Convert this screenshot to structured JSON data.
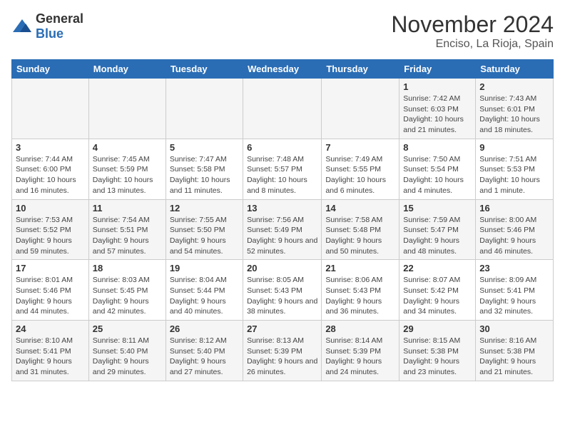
{
  "header": {
    "logo_general": "General",
    "logo_blue": "Blue",
    "month_title": "November 2024",
    "location": "Enciso, La Rioja, Spain"
  },
  "weekdays": [
    "Sunday",
    "Monday",
    "Tuesday",
    "Wednesday",
    "Thursday",
    "Friday",
    "Saturday"
  ],
  "weeks": [
    [
      {
        "day": "",
        "sunrise": "",
        "sunset": "",
        "daylight": ""
      },
      {
        "day": "",
        "sunrise": "",
        "sunset": "",
        "daylight": ""
      },
      {
        "day": "",
        "sunrise": "",
        "sunset": "",
        "daylight": ""
      },
      {
        "day": "",
        "sunrise": "",
        "sunset": "",
        "daylight": ""
      },
      {
        "day": "",
        "sunrise": "",
        "sunset": "",
        "daylight": ""
      },
      {
        "day": "1",
        "sunrise": "Sunrise: 7:42 AM",
        "sunset": "Sunset: 6:03 PM",
        "daylight": "Daylight: 10 hours and 21 minutes."
      },
      {
        "day": "2",
        "sunrise": "Sunrise: 7:43 AM",
        "sunset": "Sunset: 6:01 PM",
        "daylight": "Daylight: 10 hours and 18 minutes."
      }
    ],
    [
      {
        "day": "3",
        "sunrise": "Sunrise: 7:44 AM",
        "sunset": "Sunset: 6:00 PM",
        "daylight": "Daylight: 10 hours and 16 minutes."
      },
      {
        "day": "4",
        "sunrise": "Sunrise: 7:45 AM",
        "sunset": "Sunset: 5:59 PM",
        "daylight": "Daylight: 10 hours and 13 minutes."
      },
      {
        "day": "5",
        "sunrise": "Sunrise: 7:47 AM",
        "sunset": "Sunset: 5:58 PM",
        "daylight": "Daylight: 10 hours and 11 minutes."
      },
      {
        "day": "6",
        "sunrise": "Sunrise: 7:48 AM",
        "sunset": "Sunset: 5:57 PM",
        "daylight": "Daylight: 10 hours and 8 minutes."
      },
      {
        "day": "7",
        "sunrise": "Sunrise: 7:49 AM",
        "sunset": "Sunset: 5:55 PM",
        "daylight": "Daylight: 10 hours and 6 minutes."
      },
      {
        "day": "8",
        "sunrise": "Sunrise: 7:50 AM",
        "sunset": "Sunset: 5:54 PM",
        "daylight": "Daylight: 10 hours and 4 minutes."
      },
      {
        "day": "9",
        "sunrise": "Sunrise: 7:51 AM",
        "sunset": "Sunset: 5:53 PM",
        "daylight": "Daylight: 10 hours and 1 minute."
      }
    ],
    [
      {
        "day": "10",
        "sunrise": "Sunrise: 7:53 AM",
        "sunset": "Sunset: 5:52 PM",
        "daylight": "Daylight: 9 hours and 59 minutes."
      },
      {
        "day": "11",
        "sunrise": "Sunrise: 7:54 AM",
        "sunset": "Sunset: 5:51 PM",
        "daylight": "Daylight: 9 hours and 57 minutes."
      },
      {
        "day": "12",
        "sunrise": "Sunrise: 7:55 AM",
        "sunset": "Sunset: 5:50 PM",
        "daylight": "Daylight: 9 hours and 54 minutes."
      },
      {
        "day": "13",
        "sunrise": "Sunrise: 7:56 AM",
        "sunset": "Sunset: 5:49 PM",
        "daylight": "Daylight: 9 hours and 52 minutes."
      },
      {
        "day": "14",
        "sunrise": "Sunrise: 7:58 AM",
        "sunset": "Sunset: 5:48 PM",
        "daylight": "Daylight: 9 hours and 50 minutes."
      },
      {
        "day": "15",
        "sunrise": "Sunrise: 7:59 AM",
        "sunset": "Sunset: 5:47 PM",
        "daylight": "Daylight: 9 hours and 48 minutes."
      },
      {
        "day": "16",
        "sunrise": "Sunrise: 8:00 AM",
        "sunset": "Sunset: 5:46 PM",
        "daylight": "Daylight: 9 hours and 46 minutes."
      }
    ],
    [
      {
        "day": "17",
        "sunrise": "Sunrise: 8:01 AM",
        "sunset": "Sunset: 5:46 PM",
        "daylight": "Daylight: 9 hours and 44 minutes."
      },
      {
        "day": "18",
        "sunrise": "Sunrise: 8:03 AM",
        "sunset": "Sunset: 5:45 PM",
        "daylight": "Daylight: 9 hours and 42 minutes."
      },
      {
        "day": "19",
        "sunrise": "Sunrise: 8:04 AM",
        "sunset": "Sunset: 5:44 PM",
        "daylight": "Daylight: 9 hours and 40 minutes."
      },
      {
        "day": "20",
        "sunrise": "Sunrise: 8:05 AM",
        "sunset": "Sunset: 5:43 PM",
        "daylight": "Daylight: 9 hours and 38 minutes."
      },
      {
        "day": "21",
        "sunrise": "Sunrise: 8:06 AM",
        "sunset": "Sunset: 5:43 PM",
        "daylight": "Daylight: 9 hours and 36 minutes."
      },
      {
        "day": "22",
        "sunrise": "Sunrise: 8:07 AM",
        "sunset": "Sunset: 5:42 PM",
        "daylight": "Daylight: 9 hours and 34 minutes."
      },
      {
        "day": "23",
        "sunrise": "Sunrise: 8:09 AM",
        "sunset": "Sunset: 5:41 PM",
        "daylight": "Daylight: 9 hours and 32 minutes."
      }
    ],
    [
      {
        "day": "24",
        "sunrise": "Sunrise: 8:10 AM",
        "sunset": "Sunset: 5:41 PM",
        "daylight": "Daylight: 9 hours and 31 minutes."
      },
      {
        "day": "25",
        "sunrise": "Sunrise: 8:11 AM",
        "sunset": "Sunset: 5:40 PM",
        "daylight": "Daylight: 9 hours and 29 minutes."
      },
      {
        "day": "26",
        "sunrise": "Sunrise: 8:12 AM",
        "sunset": "Sunset: 5:40 PM",
        "daylight": "Daylight: 9 hours and 27 minutes."
      },
      {
        "day": "27",
        "sunrise": "Sunrise: 8:13 AM",
        "sunset": "Sunset: 5:39 PM",
        "daylight": "Daylight: 9 hours and 26 minutes."
      },
      {
        "day": "28",
        "sunrise": "Sunrise: 8:14 AM",
        "sunset": "Sunset: 5:39 PM",
        "daylight": "Daylight: 9 hours and 24 minutes."
      },
      {
        "day": "29",
        "sunrise": "Sunrise: 8:15 AM",
        "sunset": "Sunset: 5:38 PM",
        "daylight": "Daylight: 9 hours and 23 minutes."
      },
      {
        "day": "30",
        "sunrise": "Sunrise: 8:16 AM",
        "sunset": "Sunset: 5:38 PM",
        "daylight": "Daylight: 9 hours and 21 minutes."
      }
    ]
  ]
}
